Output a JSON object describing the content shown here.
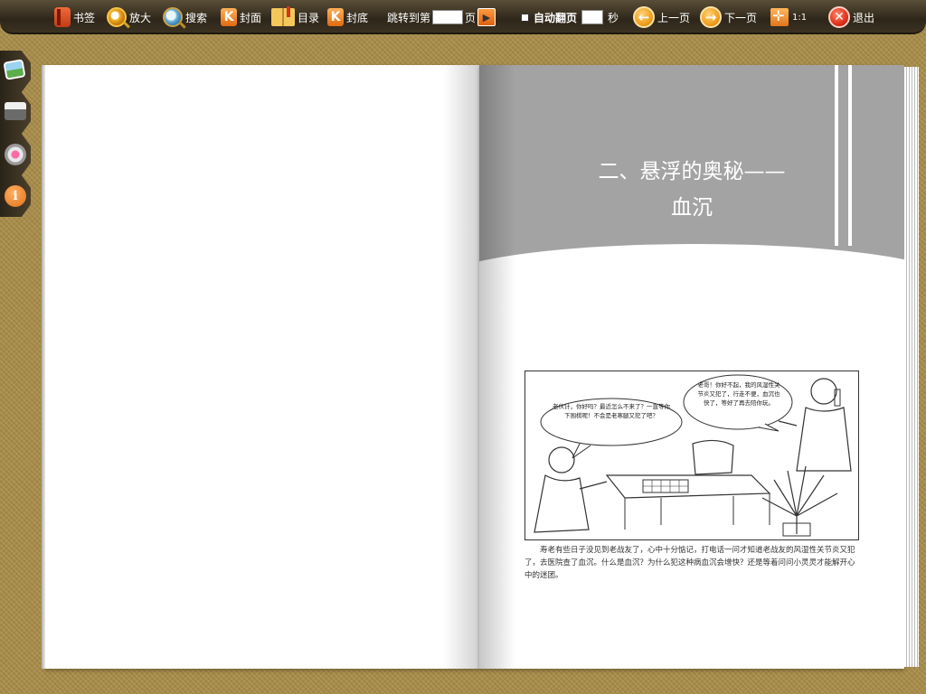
{
  "toolbar": {
    "bookmark": "书签",
    "zoom": "放大",
    "search": "搜索",
    "cover": "封面",
    "toc": "目录",
    "back_cover": "封底",
    "jump_prefix": "跳转到第",
    "jump_suffix": "页",
    "auto_flip": "自动翻页",
    "seconds": "秒",
    "prev": "上一页",
    "next": "下一页",
    "ratio": "1:1",
    "exit": "退出"
  },
  "icons": {
    "bookmark": "bookmark-icon",
    "zoom": "zoom-in-icon",
    "search": "search-icon",
    "cover": "first-page-icon",
    "toc": "book-icon",
    "back_cover": "last-page-icon",
    "go": "play-icon",
    "prev": "arrow-left-icon",
    "next": "arrow-right-icon",
    "fit": "fit-to-page-icon",
    "exit": "close-icon",
    "side": [
      "photo-icon",
      "print-icon",
      "gear-icon",
      "info-icon"
    ]
  },
  "colors": {
    "toolbar": "#2e2619",
    "background": "#a88c48",
    "header_band": "#a3a3a3",
    "accent": "#f0a020"
  },
  "book": {
    "chapter_title_line1": "二、悬浮的奥秘——",
    "chapter_title_line2": "血沉",
    "bubble_left": "老伙计，你好吗？最近怎么不来了？一直等你下围棋呢！不会是老寒腿又犯了吧？",
    "bubble_right": "老哥！你好不起，我的风湿性关节炎又犯了，行走不便，血沉也快了，等好了再去陪你玩。",
    "caption": "寿老有些日子没见到老战友了，心中十分惦记，打电话一问才知道老战友的风湿性关节炎又犯了，去医院查了血沉。什么是血沉？为什么犯这种病血沉会增快？还是等着问问小灵灵才能解开心中的迷团。"
  }
}
